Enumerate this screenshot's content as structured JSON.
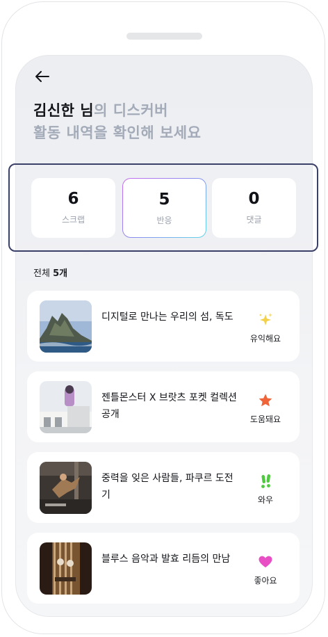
{
  "header": {
    "name_part": "김신한 님",
    "title_rest": "의 디스커버",
    "subtitle": "활동 내역을 확인해 보세요"
  },
  "stats": [
    {
      "value": "6",
      "label": "스크랩"
    },
    {
      "value": "5",
      "label": "반응"
    },
    {
      "value": "0",
      "label": "댓글"
    }
  ],
  "list": {
    "total_prefix": "전체 ",
    "total_count": "5개",
    "items": [
      {
        "title": "디지털로 만나는 우리의 섬, 독도",
        "reaction": "유익해요",
        "reaction_icon": "sparkles-icon",
        "thumb": "dokdo island photo"
      },
      {
        "title": "젠틀몬스터 X 브랏츠 포켓 컬렉션 공개",
        "reaction": "도움돼요",
        "reaction_icon": "star-icon",
        "thumb": "store building photo"
      },
      {
        "title": "중력을 잊은 사람들, 파쿠르 도전기",
        "reaction": "와우",
        "reaction_icon": "exclamation-icon",
        "thumb": "parkour jump photo"
      },
      {
        "title": "블루스 음악과 발효 리듬의 만남",
        "reaction": "좋아요",
        "reaction_icon": "heart-icon",
        "thumb": "guitar detail photo"
      }
    ]
  },
  "colors": {
    "accent_border": "#3b4069",
    "star": "#f0643a",
    "heart": "#e94fc4",
    "wow": "#4fc93f",
    "sparkle": "#f3d24a"
  }
}
